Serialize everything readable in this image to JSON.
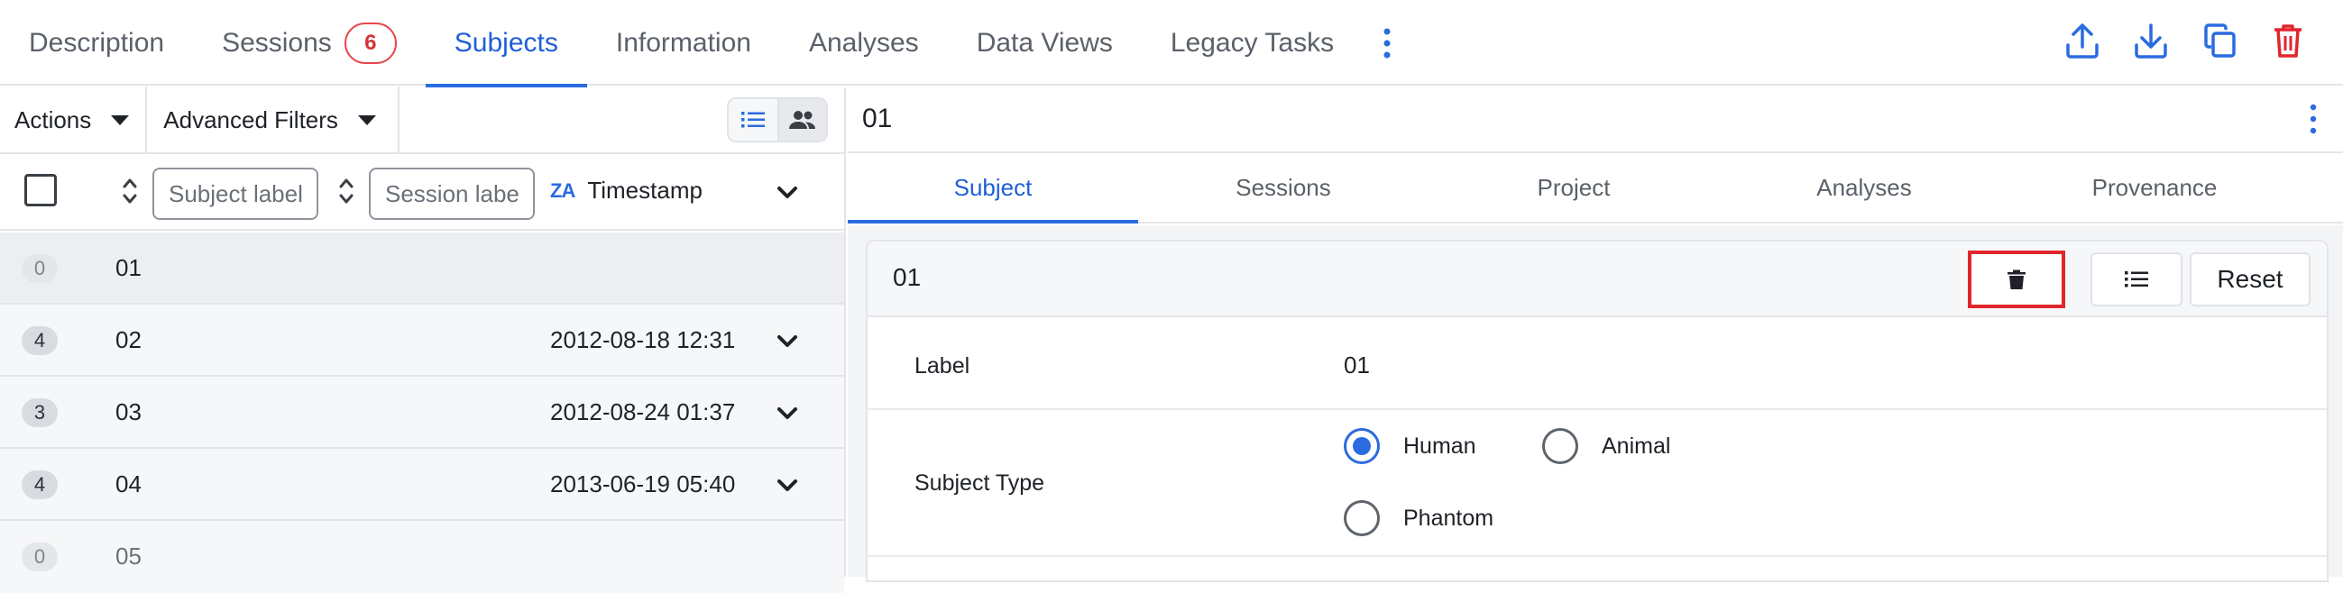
{
  "top_tabs": [
    {
      "label": "Description"
    },
    {
      "label": "Sessions",
      "badge": "6"
    },
    {
      "label": "Subjects",
      "active": true
    },
    {
      "label": "Information"
    },
    {
      "label": "Analyses"
    },
    {
      "label": "Data Views"
    },
    {
      "label": "Legacy Tasks"
    }
  ],
  "top_actions": [
    "upload-icon",
    "download-icon",
    "copy-icon",
    "delete-icon"
  ],
  "left": {
    "actions_label": "Actions",
    "advanced_filters_label": "Advanced Filters",
    "subject_label_placeholder": "Subject label",
    "session_label_placeholder": "Session label",
    "timestamp_header": "Timestamp",
    "sort_az_glyph": "ZA",
    "rows": [
      {
        "count": "0",
        "label": "01",
        "timestamp": ""
      },
      {
        "count": "4",
        "label": "02",
        "timestamp": "2012-08-18 12:31"
      },
      {
        "count": "3",
        "label": "03",
        "timestamp": "2012-08-24 01:37"
      },
      {
        "count": "4",
        "label": "04",
        "timestamp": "2013-06-19 05:40"
      },
      {
        "count": "0",
        "label": "05",
        "timestamp": ""
      }
    ]
  },
  "right": {
    "title": "01",
    "tabs": [
      {
        "label": "Subject",
        "active": true
      },
      {
        "label": "Sessions"
      },
      {
        "label": "Project"
      },
      {
        "label": "Analyses"
      },
      {
        "label": "Provenance"
      }
    ],
    "card": {
      "title": "01",
      "reset_label": "Reset",
      "fields": {
        "label_name": "Label",
        "label_value": "01",
        "subject_type_name": "Subject Type",
        "subject_type_options": [
          "Human",
          "Animal",
          "Phantom"
        ],
        "subject_type_selected": "Human"
      }
    }
  },
  "colors": {
    "accent": "#2a6be0",
    "danger": "#e0262b",
    "badge": "#e5484d"
  }
}
